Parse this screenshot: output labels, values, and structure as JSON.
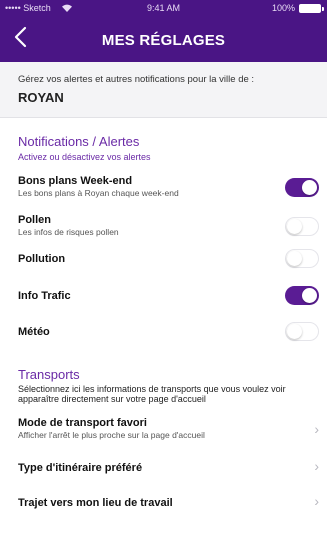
{
  "status_bar": {
    "carrier": "••••• Sketch",
    "time": "9:41 AM",
    "battery": "100%"
  },
  "header": {
    "title": "MES RÉGLAGES"
  },
  "intro": {
    "description": "Gérez vos alertes et autres notifications pour la ville de :",
    "city": "ROYAN"
  },
  "notifications": {
    "title": "Notifications / Alertes",
    "subtitle": "Activez ou désactivez vos alertes",
    "items": [
      {
        "label": "Bons plans Week-end",
        "sub": "Les bons plans à Royan chaque week-end",
        "enabled": true
      },
      {
        "label": "Pollen",
        "sub": "Les infos de risques pollen",
        "enabled": false
      },
      {
        "label": "Pollution",
        "sub": "",
        "enabled": false
      },
      {
        "label": "Info Trafic",
        "sub": "",
        "enabled": true
      },
      {
        "label": "Météo",
        "sub": "",
        "enabled": false
      }
    ]
  },
  "transports": {
    "title": "Transports",
    "subtitle": "Sélectionnez ici les informations de transports que vous voulez voir apparaître directement sur votre page d'accueil",
    "items": [
      {
        "label": "Mode de transport favori",
        "sub": "Afficher l'arrêt le plus proche sur la page d'accueil"
      },
      {
        "label": "Type d'itinéraire préféré",
        "sub": ""
      },
      {
        "label": "Trajet vers mon lieu de travail",
        "sub": ""
      }
    ]
  },
  "colors": {
    "header_bg": "#4a1585",
    "accent": "#6a2aa6",
    "toggle_on": "#5a1c94",
    "intro_bg": "#f4f4f6"
  },
  "icons": {
    "back": "chevron-left-icon",
    "row_arrow": "chevron-right-icon",
    "wifi": "wifi-icon",
    "battery": "battery-icon"
  }
}
